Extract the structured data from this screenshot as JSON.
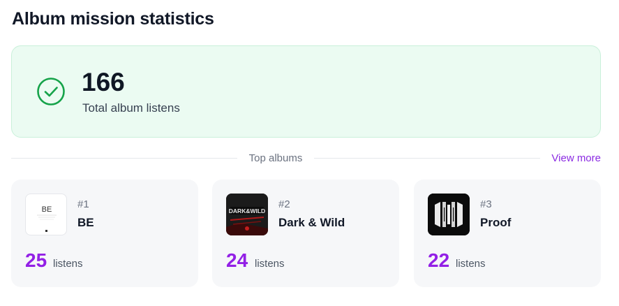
{
  "page": {
    "title": "Album mission statistics"
  },
  "summary": {
    "total_value": "166",
    "total_label": "Total album listens",
    "icon": "check-circle-icon",
    "accent": "#16a34a"
  },
  "top_albums": {
    "section_label": "Top albums",
    "view_more_label": "View more",
    "accent": "#9320e6",
    "items": [
      {
        "rank": "#1",
        "name": "BE",
        "count": "25",
        "unit": "listens",
        "cover": "be-cover"
      },
      {
        "rank": "#2",
        "name": "Dark & Wild",
        "count": "24",
        "unit": "listens",
        "cover": "dark-and-wild-cover"
      },
      {
        "rank": "#3",
        "name": "Proof",
        "count": "22",
        "unit": "listens",
        "cover": "proof-cover"
      }
    ]
  }
}
